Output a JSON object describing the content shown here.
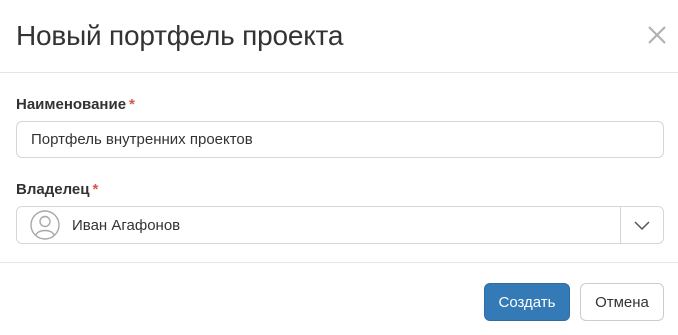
{
  "dialog": {
    "title": "Новый портфель проекта",
    "close_icon": "close-icon"
  },
  "form": {
    "name_field": {
      "label": "Наименование",
      "required_mark": "*",
      "value": "Портфель внутренних проектов"
    },
    "owner_field": {
      "label": "Владелец",
      "required_mark": "*",
      "value": "Иван Агафонов",
      "avatar_icon": "user-avatar-icon",
      "dropdown_icon": "chevron-down-icon"
    }
  },
  "footer": {
    "create_label": "Создать",
    "cancel_label": "Отмена"
  },
  "colors": {
    "primary": "#337ab7",
    "required": "#d9534f",
    "border": "#d6d6d6"
  }
}
